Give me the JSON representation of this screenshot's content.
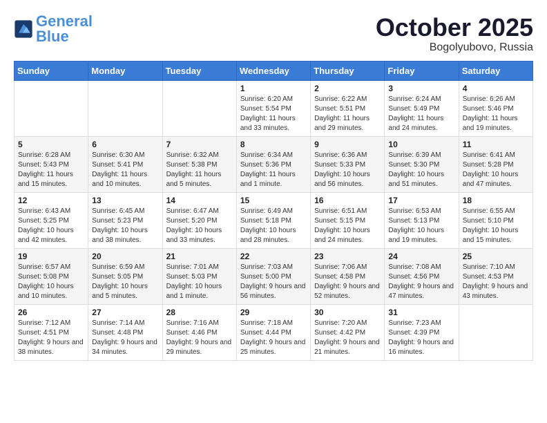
{
  "header": {
    "logo_text_general": "General",
    "logo_text_blue": "Blue",
    "month_title": "October 2025",
    "location": "Bogolyubovo, Russia"
  },
  "days_of_week": [
    "Sunday",
    "Monday",
    "Tuesday",
    "Wednesday",
    "Thursday",
    "Friday",
    "Saturday"
  ],
  "weeks": [
    [
      {
        "day": "",
        "info": ""
      },
      {
        "day": "",
        "info": ""
      },
      {
        "day": "",
        "info": ""
      },
      {
        "day": "1",
        "info": "Sunrise: 6:20 AM\nSunset: 5:54 PM\nDaylight: 11 hours and 33 minutes."
      },
      {
        "day": "2",
        "info": "Sunrise: 6:22 AM\nSunset: 5:51 PM\nDaylight: 11 hours and 29 minutes."
      },
      {
        "day": "3",
        "info": "Sunrise: 6:24 AM\nSunset: 5:49 PM\nDaylight: 11 hours and 24 minutes."
      },
      {
        "day": "4",
        "info": "Sunrise: 6:26 AM\nSunset: 5:46 PM\nDaylight: 11 hours and 19 minutes."
      }
    ],
    [
      {
        "day": "5",
        "info": "Sunrise: 6:28 AM\nSunset: 5:43 PM\nDaylight: 11 hours and 15 minutes."
      },
      {
        "day": "6",
        "info": "Sunrise: 6:30 AM\nSunset: 5:41 PM\nDaylight: 11 hours and 10 minutes."
      },
      {
        "day": "7",
        "info": "Sunrise: 6:32 AM\nSunset: 5:38 PM\nDaylight: 11 hours and 5 minutes."
      },
      {
        "day": "8",
        "info": "Sunrise: 6:34 AM\nSunset: 5:36 PM\nDaylight: 11 hours and 1 minute."
      },
      {
        "day": "9",
        "info": "Sunrise: 6:36 AM\nSunset: 5:33 PM\nDaylight: 10 hours and 56 minutes."
      },
      {
        "day": "10",
        "info": "Sunrise: 6:39 AM\nSunset: 5:30 PM\nDaylight: 10 hours and 51 minutes."
      },
      {
        "day": "11",
        "info": "Sunrise: 6:41 AM\nSunset: 5:28 PM\nDaylight: 10 hours and 47 minutes."
      }
    ],
    [
      {
        "day": "12",
        "info": "Sunrise: 6:43 AM\nSunset: 5:25 PM\nDaylight: 10 hours and 42 minutes."
      },
      {
        "day": "13",
        "info": "Sunrise: 6:45 AM\nSunset: 5:23 PM\nDaylight: 10 hours and 38 minutes."
      },
      {
        "day": "14",
        "info": "Sunrise: 6:47 AM\nSunset: 5:20 PM\nDaylight: 10 hours and 33 minutes."
      },
      {
        "day": "15",
        "info": "Sunrise: 6:49 AM\nSunset: 5:18 PM\nDaylight: 10 hours and 28 minutes."
      },
      {
        "day": "16",
        "info": "Sunrise: 6:51 AM\nSunset: 5:15 PM\nDaylight: 10 hours and 24 minutes."
      },
      {
        "day": "17",
        "info": "Sunrise: 6:53 AM\nSunset: 5:13 PM\nDaylight: 10 hours and 19 minutes."
      },
      {
        "day": "18",
        "info": "Sunrise: 6:55 AM\nSunset: 5:10 PM\nDaylight: 10 hours and 15 minutes."
      }
    ],
    [
      {
        "day": "19",
        "info": "Sunrise: 6:57 AM\nSunset: 5:08 PM\nDaylight: 10 hours and 10 minutes."
      },
      {
        "day": "20",
        "info": "Sunrise: 6:59 AM\nSunset: 5:05 PM\nDaylight: 10 hours and 5 minutes."
      },
      {
        "day": "21",
        "info": "Sunrise: 7:01 AM\nSunset: 5:03 PM\nDaylight: 10 hours and 1 minute."
      },
      {
        "day": "22",
        "info": "Sunrise: 7:03 AM\nSunset: 5:00 PM\nDaylight: 9 hours and 56 minutes."
      },
      {
        "day": "23",
        "info": "Sunrise: 7:06 AM\nSunset: 4:58 PM\nDaylight: 9 hours and 52 minutes."
      },
      {
        "day": "24",
        "info": "Sunrise: 7:08 AM\nSunset: 4:56 PM\nDaylight: 9 hours and 47 minutes."
      },
      {
        "day": "25",
        "info": "Sunrise: 7:10 AM\nSunset: 4:53 PM\nDaylight: 9 hours and 43 minutes."
      }
    ],
    [
      {
        "day": "26",
        "info": "Sunrise: 7:12 AM\nSunset: 4:51 PM\nDaylight: 9 hours and 38 minutes."
      },
      {
        "day": "27",
        "info": "Sunrise: 7:14 AM\nSunset: 4:48 PM\nDaylight: 9 hours and 34 minutes."
      },
      {
        "day": "28",
        "info": "Sunrise: 7:16 AM\nSunset: 4:46 PM\nDaylight: 9 hours and 29 minutes."
      },
      {
        "day": "29",
        "info": "Sunrise: 7:18 AM\nSunset: 4:44 PM\nDaylight: 9 hours and 25 minutes."
      },
      {
        "day": "30",
        "info": "Sunrise: 7:20 AM\nSunset: 4:42 PM\nDaylight: 9 hours and 21 minutes."
      },
      {
        "day": "31",
        "info": "Sunrise: 7:23 AM\nSunset: 4:39 PM\nDaylight: 9 hours and 16 minutes."
      },
      {
        "day": "",
        "info": ""
      }
    ]
  ]
}
